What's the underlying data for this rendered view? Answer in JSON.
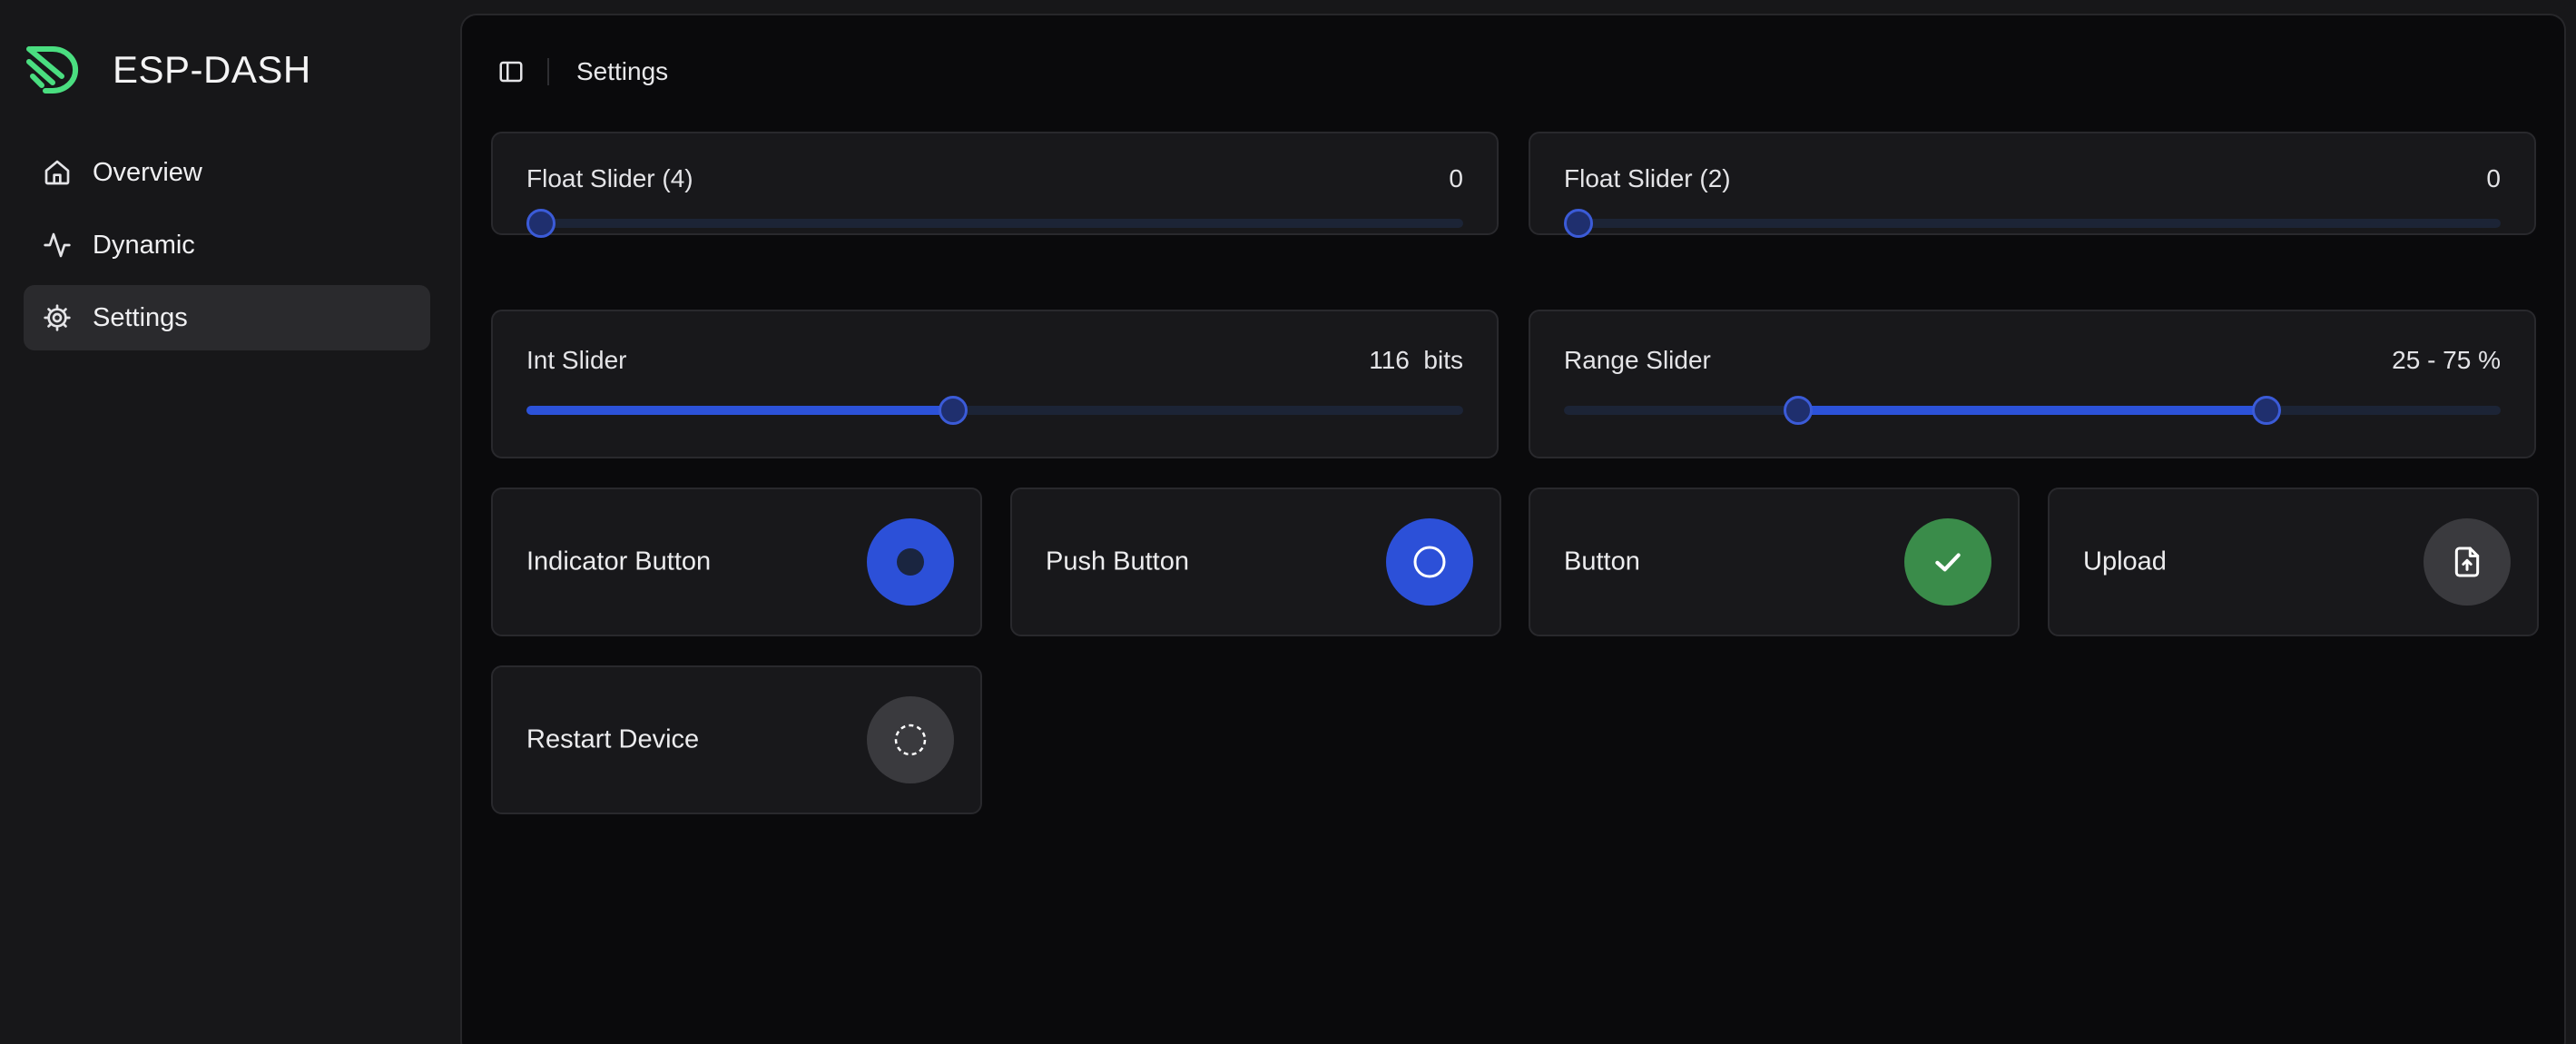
{
  "app": {
    "brand": "ESP-DASH",
    "brand_color": "#4ade80"
  },
  "sidebar": {
    "items": [
      {
        "label": "Overview",
        "icon": "home-icon",
        "active": false
      },
      {
        "label": "Dynamic",
        "icon": "activity-icon",
        "active": false
      },
      {
        "label": "Settings",
        "icon": "gear-icon",
        "active": true
      }
    ]
  },
  "header": {
    "breadcrumb": "Settings",
    "toggle_icon": "sidebar-toggle-icon"
  },
  "cards": {
    "float4": {
      "label": "Float Slider (4)",
      "value": "0",
      "level": 0
    },
    "float2": {
      "label": "Float Slider (2)",
      "value": "0",
      "level": 0
    },
    "int": {
      "label": "Int Slider",
      "value": "116  bits",
      "level": 0.455
    },
    "range": {
      "label": "Range Slider",
      "value": "25 - 75 %",
      "low": 0.25,
      "high": 0.75
    },
    "indicator": {
      "label": "Indicator Button",
      "state": "on"
    },
    "push": {
      "label": "Push Button",
      "state": "idle"
    },
    "button": {
      "label": "Button",
      "icon": "check-icon"
    },
    "upload": {
      "label": "Upload",
      "icon": "file-upload-icon"
    },
    "restart": {
      "label": "Restart Device",
      "icon": "dashed-circle-icon"
    }
  },
  "colors": {
    "accent_blue": "#2c50d8",
    "success_green": "#3a8c4a",
    "neutral": "#3a3a3e"
  }
}
